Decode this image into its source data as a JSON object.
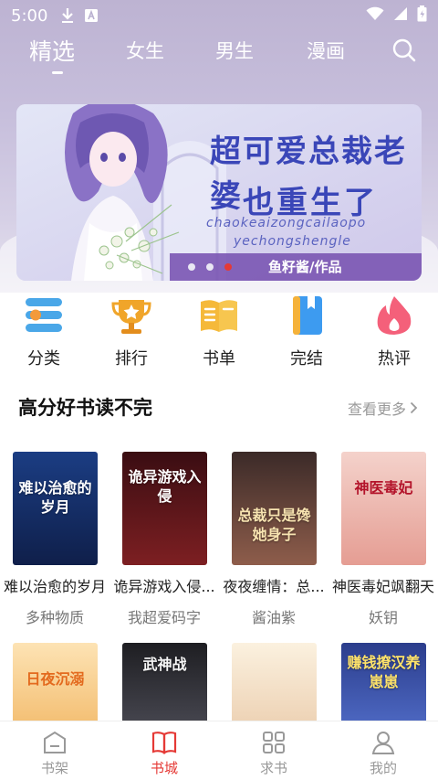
{
  "status_bar": {
    "time": "5:00"
  },
  "top_tabs": [
    "精选",
    "女生",
    "男生",
    "漫画"
  ],
  "banner": {
    "title_line1": "超可爱总裁老婆",
    "title_line2": "也重生了",
    "pinyin_line1": "chaokeaizongcailaopo",
    "pinyin_line2": "yechongshengle",
    "author": "鱼籽酱/作品"
  },
  "categories": [
    {
      "label": "分类",
      "icon": "list-icon",
      "color": "#4aa7e8"
    },
    {
      "label": "排行",
      "icon": "trophy-icon",
      "color": "#f0a52a"
    },
    {
      "label": "书单",
      "icon": "open-book-icon",
      "color": "#f5b93a"
    },
    {
      "label": "完结",
      "icon": "bookmark-book-icon",
      "color": "#3d9bf0"
    },
    {
      "label": "热评",
      "icon": "flame-icon",
      "color": "#f4607a"
    }
  ],
  "section": {
    "title": "高分好书读不完",
    "see_more": "查看更多"
  },
  "books": [
    {
      "title": "难以治愈的岁月",
      "author": "多种物质",
      "cover_text": "难以治愈的岁月",
      "cover_color": "#1f3a78"
    },
    {
      "title": "诡异游戏入侵...",
      "author": "我超爱码字",
      "cover_text": "诡异游戏入侵",
      "cover_color": "#4a1218"
    },
    {
      "title": "夜夜缠情：总...",
      "author": "酱油紫",
      "cover_text": "总裁只是馋她身子",
      "cover_color": "#5b3b33"
    },
    {
      "title": "神医毒妃飒翻天",
      "author": "妖钥",
      "cover_text": "神医毒妃",
      "cover_color": "#e9b6b0"
    }
  ],
  "books_row2": [
    {
      "cover_text": "日夜沉溺",
      "cover_color": "#f2c07a"
    },
    {
      "cover_text": "武神战",
      "cover_color": "#2c2c30"
    },
    {
      "cover_text": "",
      "cover_color": "#f1e2c9"
    },
    {
      "cover_text": "赚钱撩汉养崽崽",
      "cover_color": "#2b3d8c"
    }
  ],
  "bottom_nav": [
    {
      "label": "书架",
      "icon": "bookshelf-icon"
    },
    {
      "label": "书城",
      "icon": "bookstore-icon",
      "active": true
    },
    {
      "label": "求书",
      "icon": "grid-icon"
    },
    {
      "label": "我的",
      "icon": "user-icon"
    }
  ],
  "colors": {
    "accent": "#e53935",
    "banner_text": "#3a46b8"
  }
}
